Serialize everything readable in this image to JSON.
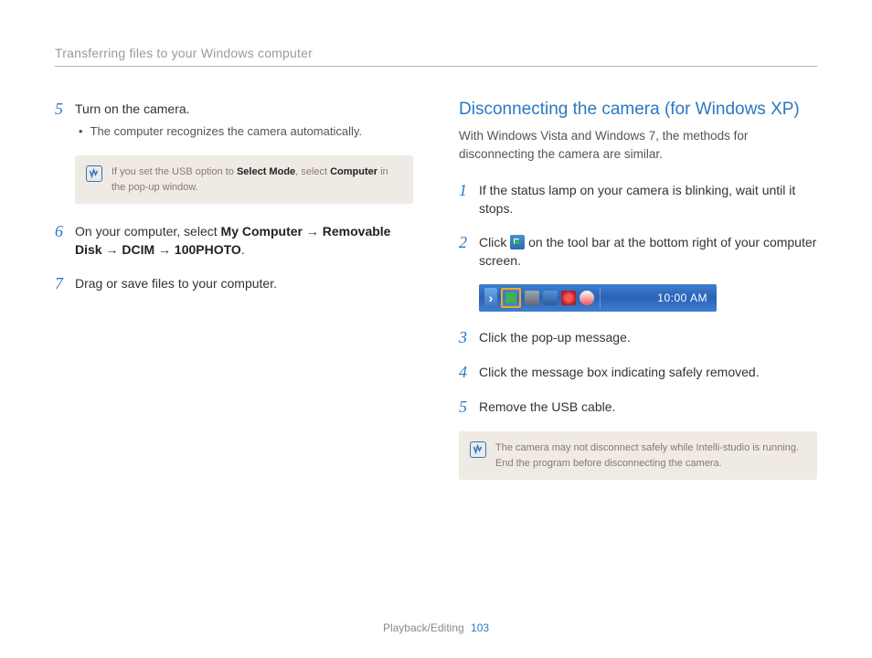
{
  "header": {
    "title": "Transferring files to your Windows computer"
  },
  "left": {
    "steps": [
      {
        "num": "5",
        "text": "Turn on the camera.",
        "bullet": "The computer recognizes the camera automatically."
      },
      {
        "num": "6",
        "html_parts": {
          "pre": "On your computer, select ",
          "b1": "My Computer",
          "arrow1": " → ",
          "b2": "Removable Disk",
          "arrow2": " → ",
          "b3": "DCIM",
          "arrow3": " → ",
          "b4": "100PHOTO",
          "post": "."
        }
      },
      {
        "num": "7",
        "text": "Drag or save files to your computer."
      }
    ],
    "note": {
      "pre": "If you set the USB option to ",
      "b1": "Select Mode",
      "mid": ", select ",
      "b2": "Computer",
      "post": " in the pop-up window."
    }
  },
  "right": {
    "heading": "Disconnecting the camera (for Windows XP)",
    "intro": "With Windows Vista and Windows 7, the methods for disconnecting the camera are similar.",
    "steps": [
      {
        "num": "1",
        "text": "If the status lamp on your camera is blinking, wait until it stops."
      },
      {
        "num": "2",
        "pre": "Click ",
        "post": " on the tool bar at the bottom right of your computer screen."
      },
      {
        "num": "3",
        "text": "Click the pop-up message."
      },
      {
        "num": "4",
        "text": "Click the message box indicating safely removed."
      },
      {
        "num": "5",
        "text": "Remove the USB cable."
      }
    ],
    "taskbar": {
      "time": "10:00 AM"
    },
    "note": "The camera may not disconnect safely while Intelli-studio is running. End the program before disconnecting the camera."
  },
  "footer": {
    "section": "Playback/Editing",
    "page": "103"
  }
}
